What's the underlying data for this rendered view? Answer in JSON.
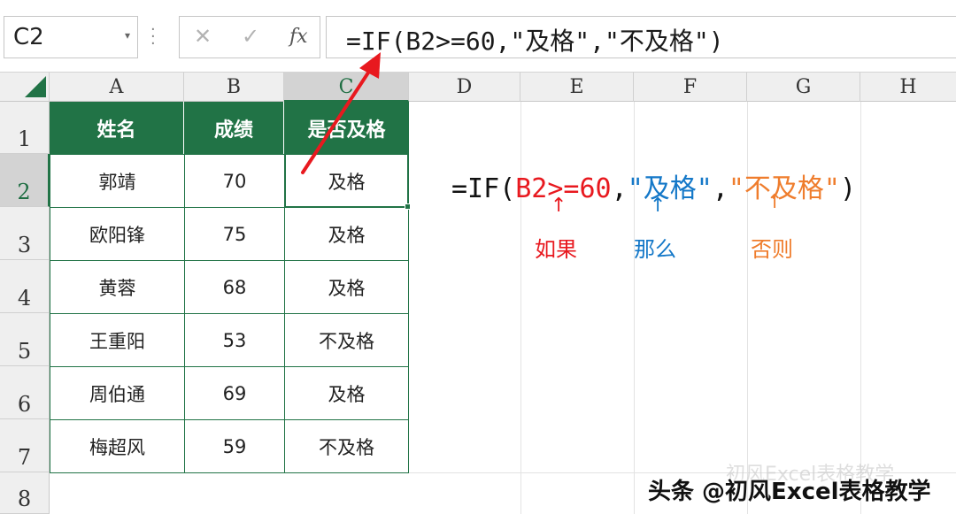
{
  "name_box": "C2",
  "formula_bar": {
    "cancel_icon": "✕",
    "enter_icon": "✓",
    "fx_label": "fx",
    "formula": "=IF(B2>=60,\"及格\",\"不及格\")"
  },
  "columns": [
    "A",
    "B",
    "C",
    "D",
    "E",
    "F",
    "G",
    "H"
  ],
  "rows": [
    "1",
    "2",
    "3",
    "4",
    "5",
    "6",
    "7",
    "8"
  ],
  "table": {
    "headers": [
      "姓名",
      "成绩",
      "是否及格"
    ],
    "rows": [
      [
        "郭靖",
        "70",
        "及格"
      ],
      [
        "欧阳锋",
        "75",
        "及格"
      ],
      [
        "黄蓉",
        "68",
        "及格"
      ],
      [
        "王重阳",
        "53",
        "不及格"
      ],
      [
        "周伯通",
        "69",
        "及格"
      ],
      [
        "梅超风",
        "59",
        "不及格"
      ]
    ]
  },
  "annotation": {
    "prefix": "=IF(",
    "condition": "B2>=60",
    "comma1": ",",
    "then_value": "\"及格\"",
    "comma2": ",",
    "else_value": "\"不及格\"",
    "suffix": ")",
    "label_if": "如果",
    "label_then": "那么",
    "label_else": "否则",
    "arrow": "↑"
  },
  "colors": {
    "accent_green": "#217346",
    "if_red": "#e8191f",
    "then_blue": "#1478c8",
    "else_orange": "#ef7d2d"
  },
  "watermark": {
    "faint": "初风Excel表格教学",
    "main": "头条 @初风Excel表格教学"
  }
}
